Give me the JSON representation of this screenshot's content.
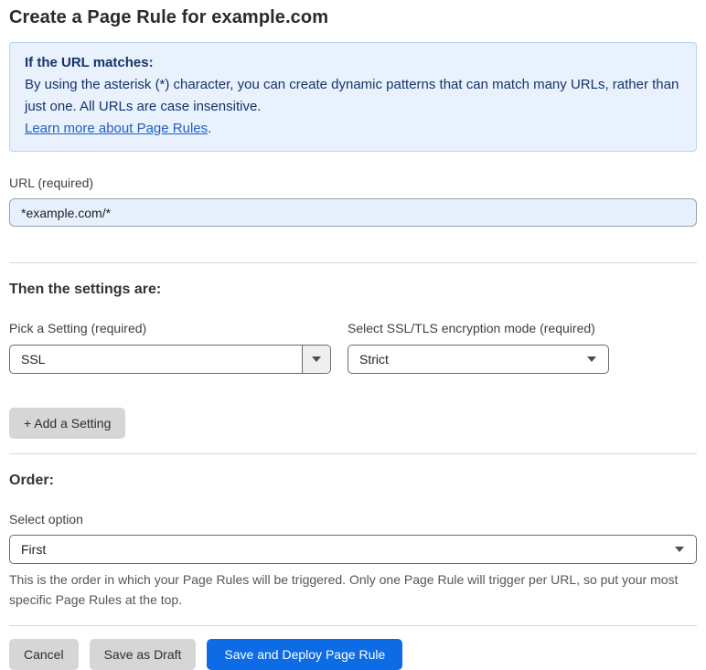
{
  "page": {
    "title": "Create a Page Rule for example.com"
  },
  "info_box": {
    "heading": "If the URL matches:",
    "body": "By using the asterisk (*) character, you can create dynamic patterns that can match many URLs, rather than just one. All URLs are case insensitive.",
    "link": "Learn more about Page Rules",
    "link_suffix": "."
  },
  "url_field": {
    "label": "URL (required)",
    "value": "*example.com/*"
  },
  "settings_section": {
    "heading": "Then the settings are:",
    "setting_picker": {
      "label": "Pick a Setting (required)",
      "value": "SSL"
    },
    "ssl_mode_picker": {
      "label": "Select SSL/TLS encryption mode (required)",
      "value": "Strict"
    },
    "add_setting_label": "+ Add a Setting"
  },
  "order_section": {
    "heading": "Order:",
    "select_label": "Select option",
    "select_value": "First",
    "help_text": "This is the order in which your Page Rules will be triggered. Only one Page Rule will trigger per URL, so put your most specific Page Rules at the top."
  },
  "footer": {
    "cancel_label": "Cancel",
    "save_draft_label": "Save as Draft",
    "save_deploy_label": "Save and Deploy Page Rule"
  },
  "icons": {
    "dropdown_caret": "chevron-down-icon"
  },
  "colors": {
    "accent_blue": "#0e6be6",
    "info_background": "#e8f1fc",
    "info_border": "#b9d3f1",
    "info_text": "#16336b",
    "link_blue": "#2060c4",
    "url_input_background": "#e7f0fd",
    "button_gray": "#d6d6d6"
  }
}
